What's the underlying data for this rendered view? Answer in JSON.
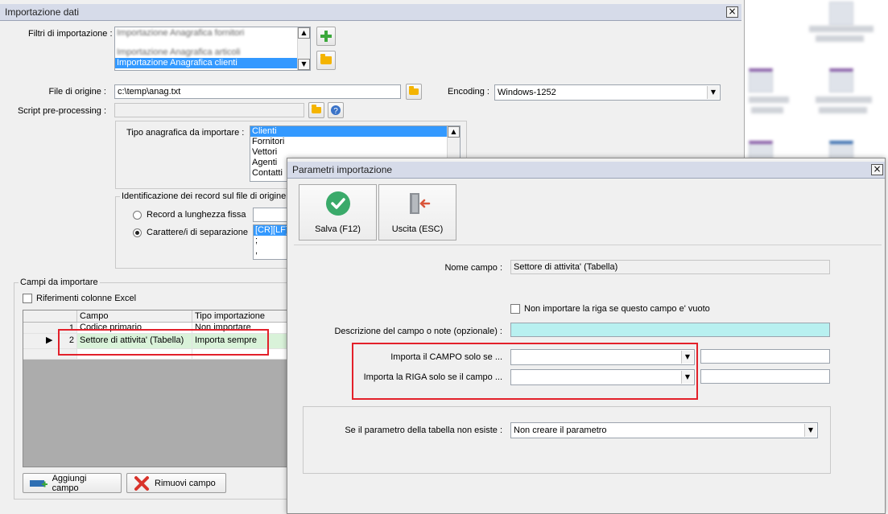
{
  "main_window": {
    "title": "Importazione dati",
    "close_glyph": "×",
    "filters_label": "Filtri di importazione :",
    "filters_list": [
      "Importazione Anagrafica fornitori",
      "Importazione Anagrafica articoli",
      "Importazione Anagrafica clienti"
    ],
    "filters_selected": "Importazione Anagrafica clienti",
    "file_label": "File di origine :",
    "file_value": "c:\\temp\\anag.txt",
    "encoding_label": "Encoding :",
    "encoding_value": "Windows-1252",
    "script_label": "Script pre-processing :",
    "script_value": "",
    "tipo_label": "Tipo anagrafica da importare :",
    "tipo_list": [
      "Clienti",
      "Fornitori",
      "Vettori",
      "Agenti",
      "Contatti"
    ],
    "identificazione_label": "Identificazione dei record sul file di origine",
    "radio_fixed_label": "Record a lunghezza fissa",
    "radio_sep_label": "Carattere/i di separazione",
    "separator_lines": [
      "[CR][LF]",
      ";",
      ","
    ],
    "campi_group_label": "Campi da importare",
    "riferimenti_label": "Riferimenti colonne Excel",
    "grid": {
      "columns": [
        "Campo",
        "Tipo importazione"
      ],
      "rows": [
        {
          "num": "1",
          "campo": "Codice primario",
          "tipo": "Non importare"
        },
        {
          "num": "2",
          "campo": "Settore di attivita' (Tabella)",
          "tipo": "Importa sempre"
        }
      ],
      "current_row_marker": "▶"
    },
    "add_button": "Aggiungi campo",
    "remove_button": "Rimuovi campo"
  },
  "dialog": {
    "title": "Parametri importazione",
    "close_glyph": "×",
    "save_button": "Salva (F12)",
    "exit_button": "Uscita (ESC)",
    "nome_campo_label": "Nome campo :",
    "nome_campo_value": "Settore di attivita' (Tabella)",
    "non_importare_label": "Non importare la riga se questo campo e' vuoto",
    "descrizione_label": "Descrizione del campo o note (opzionale) :",
    "descrizione_value": "",
    "importa_campo_label": "Importa il CAMPO solo se ...",
    "importa_campo_value": "",
    "importa_campo_text": "",
    "importa_riga_label": "Importa la RIGA solo se il campo ...",
    "importa_riga_value": "",
    "importa_riga_text": "",
    "parametro_label": "Se il parametro della tabella non esiste :",
    "parametro_value": "Non creare il parametro"
  },
  "colors": {
    "titlebar": "#d6dbe9",
    "highlight_select": "#3399ff",
    "description_field": "#b8f0f0",
    "red_annotation": "#e3202a",
    "save_icon": "#3aaa6a",
    "exit_icon": "#d9553a"
  }
}
